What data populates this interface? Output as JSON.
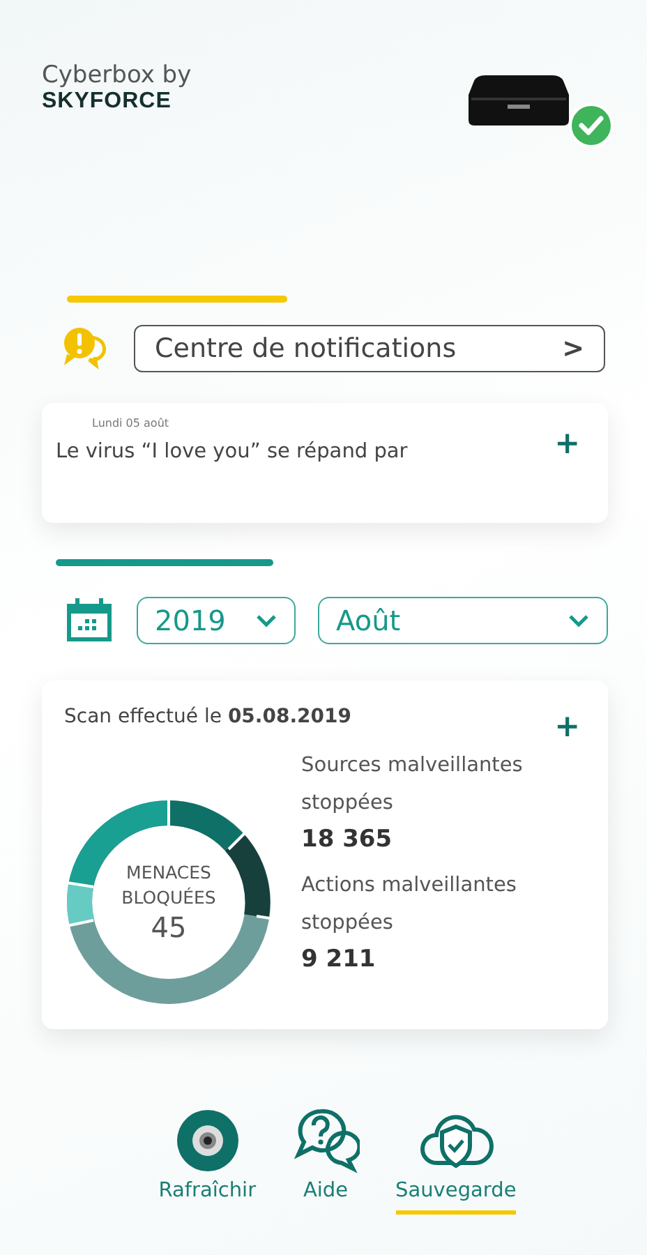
{
  "header": {
    "title": "Cyberbox by",
    "brand": "SKYFORCE",
    "device_connected": true
  },
  "notifications": {
    "button": "Centre de notifications",
    "arrow": ">",
    "item": {
      "date": "Lundi 05 août",
      "text": "Le virus “I love you” se répand par",
      "action": "+"
    }
  },
  "period": {
    "year": "2019",
    "month": "Août"
  },
  "scan": {
    "label": "Scan effectué le **05.08.2019**",
    "action": "+",
    "donut": {
      "title_1": "MENACES",
      "title_2": "BLOQUÉES",
      "total": "45"
    },
    "stats": [
      {
        "label": "Sources malveillantes stoppées",
        "value": "18 365"
      },
      {
        "label": "Actions malveillantes stoppées",
        "value": "9 211"
      }
    ]
  },
  "nav": [
    {
      "label": "Rafraîchir",
      "kind": "refresh",
      "selected": false
    },
    {
      "label": "Aide",
      "kind": "help",
      "selected": false
    },
    {
      "label": "Sauvegarde",
      "kind": "backup",
      "selected": true
    }
  ]
}
